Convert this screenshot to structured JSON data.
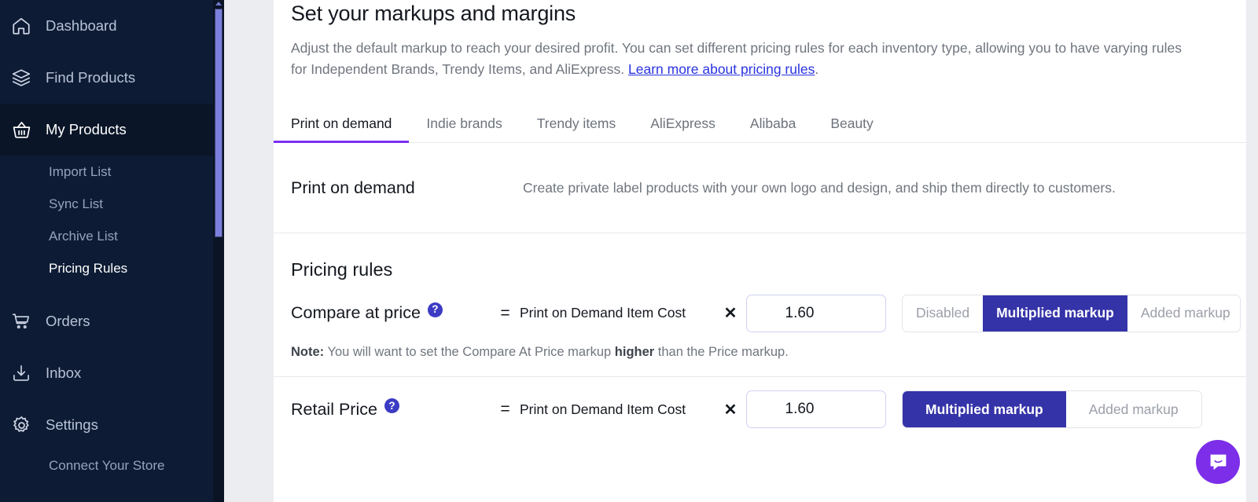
{
  "sidebar": {
    "items": [
      {
        "label": "Dashboard",
        "icon": "home-icon",
        "active": false
      },
      {
        "label": "Find Products",
        "icon": "layers-icon",
        "active": false
      },
      {
        "label": "My Products",
        "icon": "basket-icon",
        "active": true
      },
      {
        "label": "Orders",
        "icon": "cart-icon",
        "active": false
      },
      {
        "label": "Inbox",
        "icon": "inbox-download-icon",
        "active": false
      },
      {
        "label": "Settings",
        "icon": "gear-icon",
        "active": false
      }
    ],
    "subitems": [
      {
        "label": "Import List",
        "current": false
      },
      {
        "label": "Sync List",
        "current": false
      },
      {
        "label": "Archive List",
        "current": false
      },
      {
        "label": "Pricing Rules",
        "current": true
      }
    ],
    "footer_item": {
      "label": "Connect Your Store"
    },
    "colors": {
      "bg": "#0d1b34",
      "active_bg": "#0a1628",
      "scrollbar_thumb": "#7b80dd"
    }
  },
  "header": {
    "title": "Set your markups and margins",
    "desc_part1": "Adjust the default markup to reach your desired profit. You can set different pricing rules for each inventory type, allowing you to have varying rules for Independent Brands, Trendy Items, and AliExpress. ",
    "link_text": "Learn more about pricing rules",
    "desc_part2": "."
  },
  "tabs": [
    {
      "label": "Print on demand",
      "active": true
    },
    {
      "label": "Indie brands",
      "active": false
    },
    {
      "label": "Trendy items",
      "active": false
    },
    {
      "label": "AliExpress",
      "active": false
    },
    {
      "label": "Alibaba",
      "active": false
    },
    {
      "label": "Beauty",
      "active": false
    }
  ],
  "info_band": {
    "name": "Print on demand",
    "description": "Create private label products with your own logo and design, and ship them directly to customers."
  },
  "pricing": {
    "section_title": "Pricing rules",
    "help_glyph": "?",
    "eq_symbol": "=",
    "times_symbol": "✕",
    "rows": [
      {
        "label": "Compare at price",
        "cost_source": "Print on Demand Item Cost",
        "value": "1.60",
        "placeholder": "1.00",
        "options": [
          {
            "label": "Disabled",
            "selected": false
          },
          {
            "label": "Multiplied markup",
            "selected": true
          },
          {
            "label": "Added markup",
            "selected": false
          }
        ]
      },
      {
        "label": "Retail Price",
        "cost_source": "Print on Demand Item Cost",
        "value": "1.60",
        "placeholder": "1.00",
        "options": [
          {
            "label": "Multiplied markup",
            "selected": true
          },
          {
            "label": "Added markup",
            "selected": false
          }
        ]
      }
    ],
    "note_prefix": "Note:",
    "note_text_a": " You will want to set the Compare At Price markup ",
    "note_bold": "higher",
    "note_text_b": " than the Price markup."
  },
  "chat": {
    "name": "intercom-launcher",
    "color": "#7c2ee8"
  },
  "colors": {
    "accent_purple": "#7b2ff2",
    "selected_segment": "#3533a8",
    "link_blue": "#2a33e0",
    "gutter_gray": "#ecedf1"
  }
}
